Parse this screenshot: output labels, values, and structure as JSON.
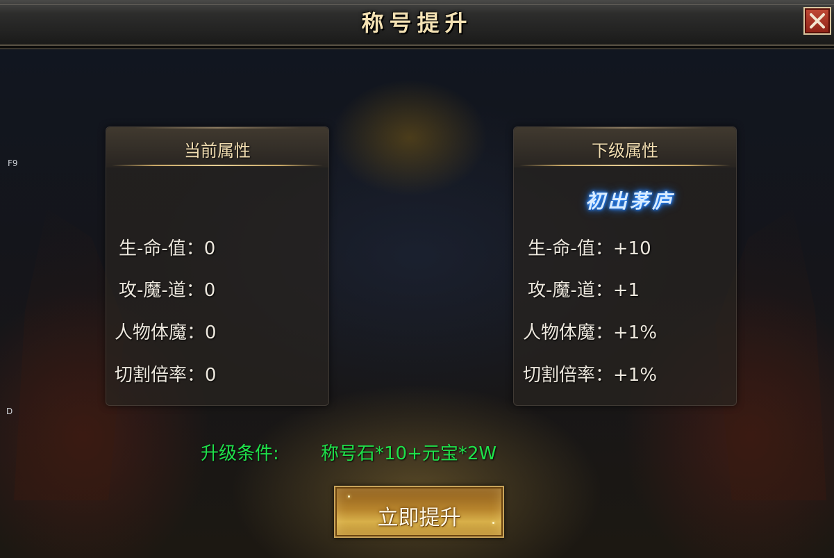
{
  "window": {
    "title": "称号提升",
    "close_icon": "close-icon",
    "side_labels": [
      "F9",
      "D"
    ]
  },
  "current_panel": {
    "title": "当前属性",
    "stats": [
      {
        "label": "生-命-值：",
        "value": "0"
      },
      {
        "label": "攻-魔-道：",
        "value": "0"
      },
      {
        "label": "人物体魔：",
        "value": "0"
      },
      {
        "label": "切割倍率：",
        "value": "0"
      }
    ]
  },
  "next_panel": {
    "title": "下级属性",
    "badge": "初出茅庐",
    "stats": [
      {
        "label": "生-命-值：",
        "value": "+10"
      },
      {
        "label": "攻-魔-道：",
        "value": "+1"
      },
      {
        "label": "人物体魔：",
        "value": "+1%"
      },
      {
        "label": "切割倍率：",
        "value": "+1%"
      }
    ]
  },
  "upgrade": {
    "condition_label": "升级条件:",
    "condition_value": "称号石*10+元宝*2W",
    "button_label": "立即提升"
  },
  "colors": {
    "condition_green": "#1fe04a",
    "title_gold": "#f4e2b4",
    "badge_blue": "#2f8cff",
    "button_gold": "#d8b04a"
  }
}
